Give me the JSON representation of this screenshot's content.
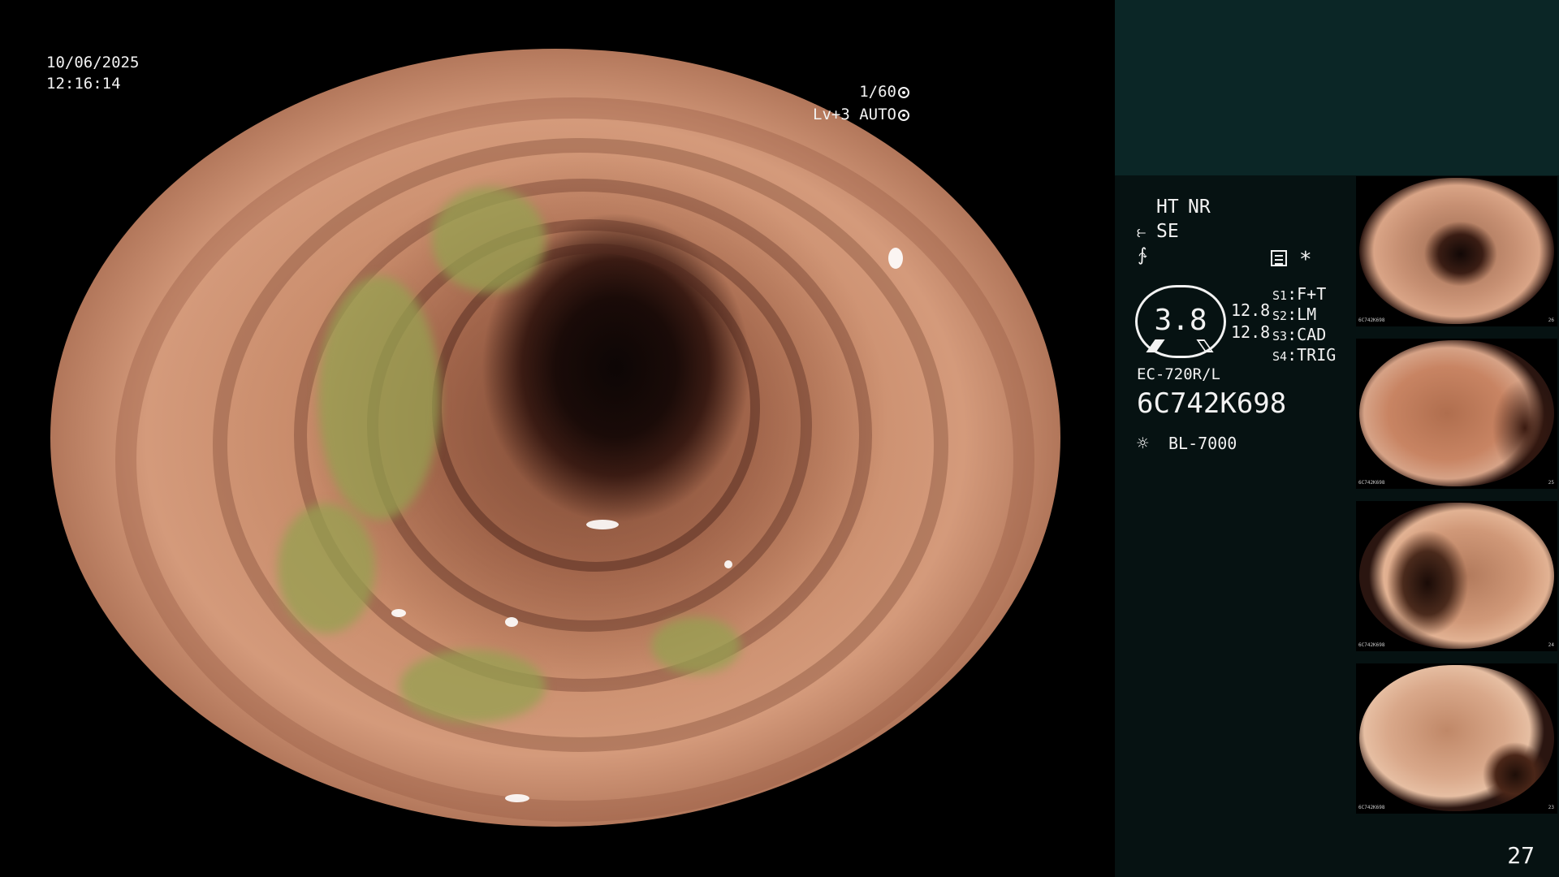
{
  "overlay": {
    "date": "10/06/2025",
    "time": "12:16:14",
    "shutter": "1/60",
    "level": "Lv+3",
    "mode": "AUTO"
  },
  "panel": {
    "ht": "HT",
    "nr": "NR",
    "se": "SE",
    "star": "*",
    "gauge_value": "3.8",
    "left_values": [
      "12.8",
      "12.8"
    ],
    "switches": [
      {
        "key": "S1",
        "label": "F+T"
      },
      {
        "key": "S2",
        "label": "LM"
      },
      {
        "key": "S3",
        "label": "CAD"
      },
      {
        "key": "S4",
        "label": "TRIG"
      }
    ],
    "scope_model": "EC-720R/L",
    "serial": "6C742K698",
    "light_source": "BL-7000",
    "page": "27"
  },
  "thumbnails": [
    {
      "serial": "6C742K698",
      "index": "26"
    },
    {
      "serial": "6C742K698",
      "index": "25"
    },
    {
      "serial": "6C742K698",
      "index": "24"
    },
    {
      "serial": "6C742K698",
      "index": "23"
    }
  ],
  "colors": {
    "accent_orange": "#f0a020",
    "panel_bg": "#061212",
    "panel_top_bg": "#0b2626"
  },
  "icons": [
    "shutter-icon",
    "auto-iris-icon",
    "structure-enhance-icon",
    "color-enhance-icon",
    "menu-icon",
    "lamp-icon"
  ]
}
